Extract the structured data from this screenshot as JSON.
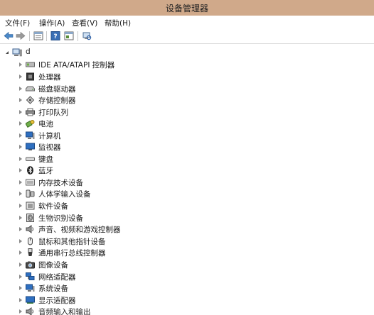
{
  "window": {
    "title": "设备管理器"
  },
  "menu": [
    {
      "label": "文件(F)"
    },
    {
      "label": "操作(A)"
    },
    {
      "label": "查看(V)"
    },
    {
      "label": "帮助(H)"
    }
  ],
  "toolbar": [
    {
      "icon": "back-arrow-icon"
    },
    {
      "icon": "forward-arrow-icon"
    },
    {
      "icon": "properties-icon"
    },
    {
      "icon": "help-icon"
    },
    {
      "icon": "update-driver-icon"
    },
    {
      "icon": "scan-hardware-icon"
    }
  ],
  "tree": {
    "root": {
      "label": "d",
      "expanded": true,
      "icon": "computer-root-icon"
    },
    "categories": [
      {
        "label": "IDE ATA/ATAPI 控制器",
        "icon": "ide-controller-icon"
      },
      {
        "label": "处理器",
        "icon": "processor-icon"
      },
      {
        "label": "磁盘驱动器",
        "icon": "disk-drive-icon"
      },
      {
        "label": "存储控制器",
        "icon": "storage-controller-icon"
      },
      {
        "label": "打印队列",
        "icon": "printer-icon"
      },
      {
        "label": "电池",
        "icon": "battery-icon"
      },
      {
        "label": "计算机",
        "icon": "computer-icon"
      },
      {
        "label": "监视器",
        "icon": "monitor-icon"
      },
      {
        "label": "键盘",
        "icon": "keyboard-icon"
      },
      {
        "label": "蓝牙",
        "icon": "bluetooth-icon"
      },
      {
        "label": "内存技术设备",
        "icon": "memory-device-icon"
      },
      {
        "label": "人体学输入设备",
        "icon": "hid-icon"
      },
      {
        "label": "软件设备",
        "icon": "software-device-icon"
      },
      {
        "label": "生物识别设备",
        "icon": "biometric-icon"
      },
      {
        "label": "声音、视频和游戏控制器",
        "icon": "speaker-icon"
      },
      {
        "label": "鼠标和其他指针设备",
        "icon": "mouse-icon"
      },
      {
        "label": "通用串行总线控制器",
        "icon": "usb-icon"
      },
      {
        "label": "图像设备",
        "icon": "camera-icon"
      },
      {
        "label": "网络适配器",
        "icon": "network-adapter-icon"
      },
      {
        "label": "系统设备",
        "icon": "system-device-icon"
      },
      {
        "label": "显示适配器",
        "icon": "display-adapter-icon"
      },
      {
        "label": "音频输入和输出",
        "icon": "audio-io-icon"
      }
    ]
  },
  "colors": {
    "titlebar": "#d0a98a",
    "background": "#ffffff",
    "text": "#1a1a1a"
  }
}
